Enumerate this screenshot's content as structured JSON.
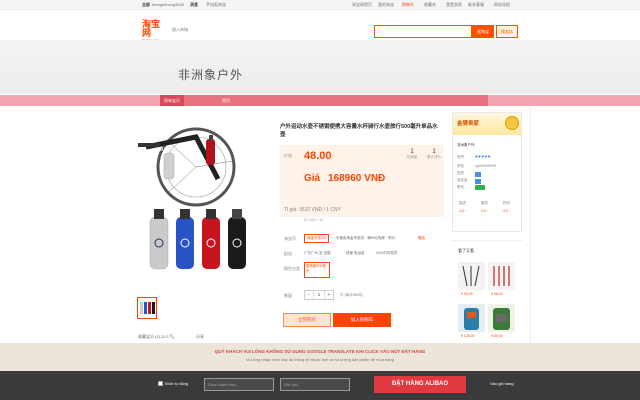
{
  "topnav": {
    "items": [
      "全部",
      "thenghithong3630",
      "消息",
      "手机逛淘宝",
      "我是卖家",
      "千牛卖家中心",
      "联系客服",
      "网站导航",
      "我的淘宝",
      "收藏夹",
      "购物车",
      "淘宝网首页",
      "我是卖家",
      "网站导航"
    ]
  },
  "header": {
    "logo_zh": "淘宝网",
    "logo_en": "Taobao.com",
    "enter_market": "进入市场",
    "search_btn": "搜淘宝",
    "search_btn2": "搜本店"
  },
  "shop": {
    "name": "非洲象户外",
    "nav": [
      "所有宝贝",
      "首页"
    ]
  },
  "product": {
    "title": "户外运动水壶不锈钢便携大容量水杯骑行水壶旅行500毫升单品水壶",
    "price_label": "价格",
    "price": "48.00",
    "price_vnd_label": "Giá",
    "price_vnd": "168960 VNĐ",
    "counters": [
      {
        "n": "1",
        "l": "月销量"
      },
      {
        "n": "1",
        "l": "累计评价"
      }
    ],
    "rate": "Tỉ giá: 3520 VNĐ / 1 CNY",
    "rate_sub": "约 US$ 7.36",
    "promo_label": "淘金币",
    "promo_tag": "淘金币抵2%",
    "promo_text": "可使用淘金币抵扣 · 满99元免邮 · 积分",
    "promo_icon": "赠送",
    "ship_label": "配送",
    "ship_from": "广东广州 至 全国",
    "ship_fee": "快递 免运费",
    "ship_time": "24小时内发货",
    "variant_label": "颜色分类",
    "variant": "银色款500毫升",
    "qty_label": "数量",
    "qty": "1",
    "stock": "件 (库存983件)",
    "buy": "立刻购买",
    "cart": "加入购物车",
    "thumb_links": [
      "收藏宝贝 (1122人气)",
      "分享"
    ]
  },
  "shop_card": {
    "badge": "金牌卖家",
    "name": "非洲象户外",
    "credit_label": "信誉",
    "hearts": "♥♥♥♥♥",
    "shop_label": "掌柜",
    "shop_val": "sgb99999999",
    "rows": [
      "资质",
      "保证金",
      "联系"
    ],
    "score_heads": [
      "描述",
      "服务",
      "物流"
    ],
    "score_vals": [
      "4.9 ↑",
      "4.9 ↑",
      "4.9 ↑"
    ]
  },
  "side": {
    "title": "看了又看",
    "prices": [
      "¥ 95.00",
      "¥ 58.00",
      "¥ 128.00",
      "¥ 60.00"
    ]
  },
  "warning": {
    "line1": "QUÝ KHÁCH VUI LÒNG KHÔNG SỬ DỤNG GOOGLE TRANSLATE KHI CLICK VÀO NÚT ĐẶT HÀNG",
    "line2": "Vui lòng nhập chọn đầy đủ thông tin thuộc tính và số lượng sản phẩm để mua hàng"
  },
  "bottombar": {
    "check_label": "Đích tự động",
    "input1": "Chọn danh mục",
    "input2": "Ghi chú",
    "order": "ĐẶT HÀNG ALIBAO",
    "cart": "Vào giỏ hàng"
  },
  "colors": {
    "accent": "#ff4400",
    "shopnav": "#e8717f",
    "order_button": "#e03a40"
  }
}
